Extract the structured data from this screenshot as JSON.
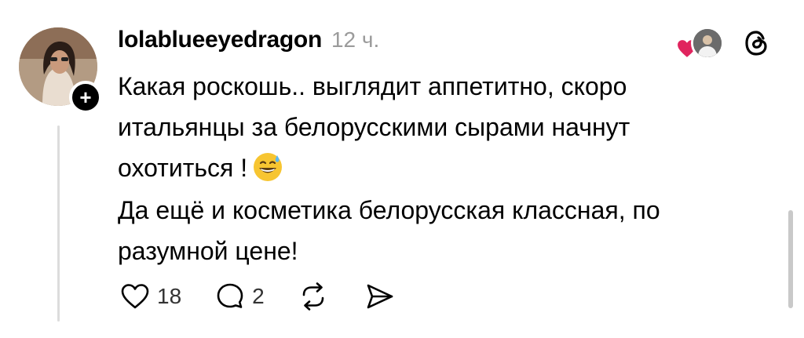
{
  "post": {
    "username": "lolablueeyedragon",
    "time": "12 ч.",
    "paragraphs": [
      "Какая роскошь.. выглядит аппетитно, скоро итальянцы за белорусскими сырами начнут охотиться !",
      "Да ещё и косметика  белорусская классная, по разумной цене!"
    ],
    "emoji": "grinning-face-with-sweat",
    "follow_icon": "plus-icon",
    "liked_by_icon": "heart-icon"
  },
  "actions": {
    "likes": "18",
    "replies": "2"
  },
  "colors": {
    "heart": "#e0245e",
    "muted": "#9b9b9b",
    "thread_line": "#dcdcdc"
  }
}
